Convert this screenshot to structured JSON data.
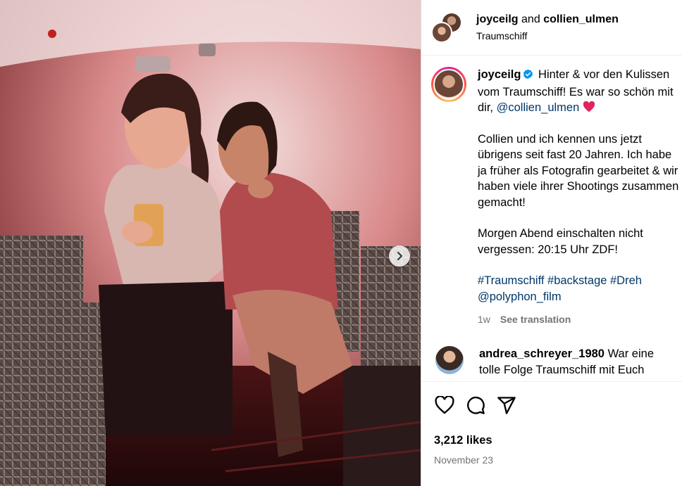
{
  "header": {
    "author": "joyceilg",
    "conjunction": "and",
    "coauthor": "collien_ulmen",
    "location": "Traumschiff"
  },
  "caption": {
    "username": "joyceilg",
    "line1": "Hinter & vor den Kulissen vom Traumschiff! Es war so schön mit dir, ",
    "mention": "@collien_ulmen",
    "heart": "❤️",
    "para2": "Collien und ich kennen uns jetzt übrigens seit fast 20 Jahren. Ich habe ja früher als Fotografin gearbeitet & wir haben viele ihrer Shootings zusammen gemacht!",
    "para3": "Morgen Abend einschalten nicht vergessen: 20:15 Uhr ZDF!",
    "hashtags": "#Traumschiff #backstage #Dreh",
    "mention2": "@polyphon_film",
    "age": "1w",
    "see_translation": "See translation"
  },
  "comment": {
    "username": "andrea_schreyer_1980",
    "text": "War eine tolle Folge Traumschiff mit Euch"
  },
  "icons": {
    "like": "heart-icon",
    "comment": "comment-icon",
    "share": "share-icon",
    "next": "chevron-right-icon"
  },
  "stats": {
    "likes": "3,212 likes",
    "date": "November 23"
  },
  "colors": {
    "link": "#00376b",
    "verified": "#0095f6",
    "heart": "#e0245e",
    "secondary_text": "#737373"
  }
}
